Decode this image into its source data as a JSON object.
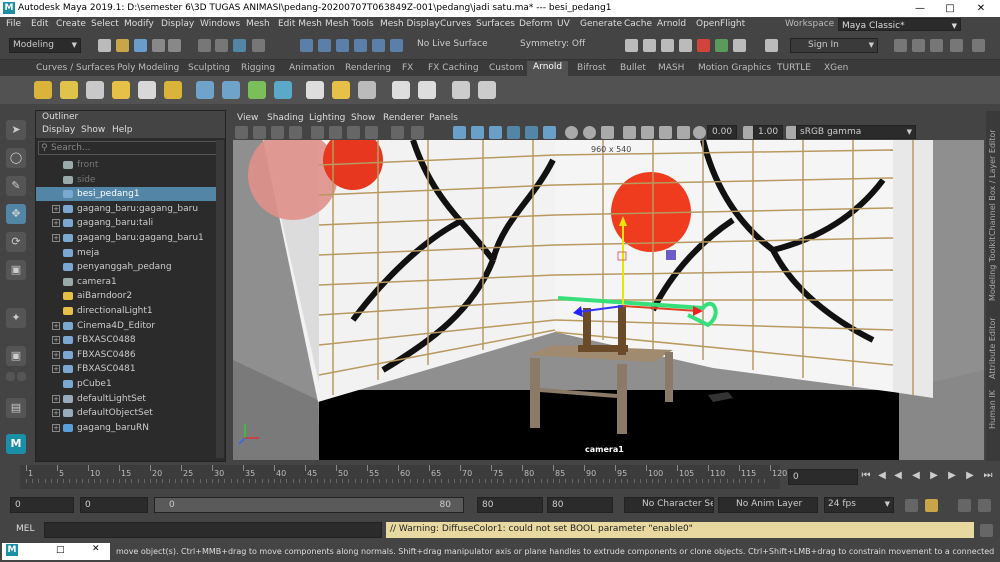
{
  "app": {
    "title": "Autodesk Maya 2019.1: D:\\semester 6\\3D TUGAS ANIMASI\\pedang-20200707T063849Z-001\\pedang\\jadi satu.ma*   ---   besi_pedang1",
    "logo": "M"
  },
  "menubar": [
    "File",
    "Edit",
    "Create",
    "Select",
    "Modify",
    "Display",
    "Windows",
    "Mesh",
    "Edit Mesh",
    "Mesh Tools",
    "Mesh Display",
    "Curves",
    "Surfaces",
    "Deform",
    "UV",
    "Generate",
    "Cache",
    "Arnold",
    "OpenFlight"
  ],
  "workspace": {
    "label": "Workspace :",
    "value": "Maya Classic*"
  },
  "status": {
    "mode": "Modeling",
    "live_surface": "No Live Surface",
    "symmetry": "Symmetry: Off",
    "sign_in": "Sign In"
  },
  "shelf_tabs": [
    "Curves / Surfaces",
    "Poly Modeling",
    "Sculpting",
    "Rigging",
    "Animation",
    "Rendering",
    "FX",
    "FX Caching",
    "Custom",
    "Arnold",
    "Bifrost",
    "Bullet",
    "MASH",
    "Motion Graphics",
    "TURTLE",
    "XGen"
  ],
  "shelf_active": "Arnold",
  "outliner": {
    "title": "Outliner",
    "menu": [
      "Display",
      "Show",
      "Help"
    ],
    "search_placeholder": "Search...",
    "items": [
      {
        "label": "front",
        "expand": false,
        "dim": true,
        "icon": "camera-icon"
      },
      {
        "label": "side",
        "expand": false,
        "dim": true,
        "icon": "camera-icon"
      },
      {
        "label": "besi_pedang1",
        "expand": false,
        "selected": true,
        "icon": "mesh-icon"
      },
      {
        "label": "gagang_baru:gagang_baru",
        "expand": true,
        "icon": "mesh-icon"
      },
      {
        "label": "gagang_baru:tali",
        "expand": true,
        "icon": "mesh-icon"
      },
      {
        "label": "gagang_baru:gagang_baru1",
        "expand": true,
        "icon": "mesh-icon"
      },
      {
        "label": "meja",
        "expand": false,
        "icon": "mesh-icon"
      },
      {
        "label": "penyanggah_pedang",
        "expand": false,
        "icon": "mesh-icon"
      },
      {
        "label": "camera1",
        "expand": false,
        "icon": "camera-icon"
      },
      {
        "label": "aiBarndoor2",
        "expand": false,
        "icon": "light-icon"
      },
      {
        "label": "directionalLight1",
        "expand": false,
        "icon": "light-icon"
      },
      {
        "label": "Cinema4D_Editor",
        "expand": true,
        "icon": "mesh-icon"
      },
      {
        "label": "FBXASC0488",
        "expand": true,
        "icon": "mesh-icon"
      },
      {
        "label": "FBXASC0486",
        "expand": true,
        "icon": "mesh-icon"
      },
      {
        "label": "FBXASC0481",
        "expand": true,
        "icon": "mesh-icon"
      },
      {
        "label": "pCube1",
        "expand": false,
        "icon": "mesh-icon"
      },
      {
        "label": "defaultLightSet",
        "expand": true,
        "icon": "set-icon"
      },
      {
        "label": "defaultObjectSet",
        "expand": true,
        "icon": "set-icon"
      },
      {
        "label": "gagang_baruRN",
        "expand": true,
        "icon": "reference-icon"
      }
    ]
  },
  "panel": {
    "menu": [
      "View",
      "Shading",
      "Lighting",
      "Show",
      "Renderer",
      "Panels"
    ],
    "exposure": "0.00",
    "gamma": "1.00",
    "color_space": "sRGB gamma",
    "resolution": "960 x 540",
    "camera_label": "camera1"
  },
  "right_tabs": [
    "Channel Box / Layer Editor",
    "Modeling Toolkit",
    "Attribute Editor",
    "Human IK"
  ],
  "timeline": {
    "ticks": [
      "1",
      "5",
      "10",
      "15",
      "20",
      "25",
      "30",
      "35",
      "40",
      "45",
      "50",
      "55",
      "60",
      "65",
      "70",
      "75",
      "80",
      "85",
      "90",
      "95",
      "100",
      "105",
      "110",
      "115",
      "120"
    ],
    "current_frame": "0"
  },
  "range": {
    "start": "0",
    "anim_start": "0",
    "slider_start": "0",
    "slider_end": "80",
    "anim_end": "80",
    "end": "80",
    "character_set": "No Character Set",
    "anim_layer": "No Anim Layer",
    "fps": "24 fps"
  },
  "cmd": {
    "label": "MEL",
    "warning": "// Warning: DiffuseColor1: could not set BOOL parameter \"enable0\""
  },
  "help": "move object(s). Ctrl+MMB+drag to move components along normals. Shift+drag manipulator axis or plane handles to extrude components or clone objects. Ctrl+Shift+LMB+drag to constrain movement to a connected edge. Use D or INSERT to change the pivot position a",
  "accent": "#5285a6"
}
